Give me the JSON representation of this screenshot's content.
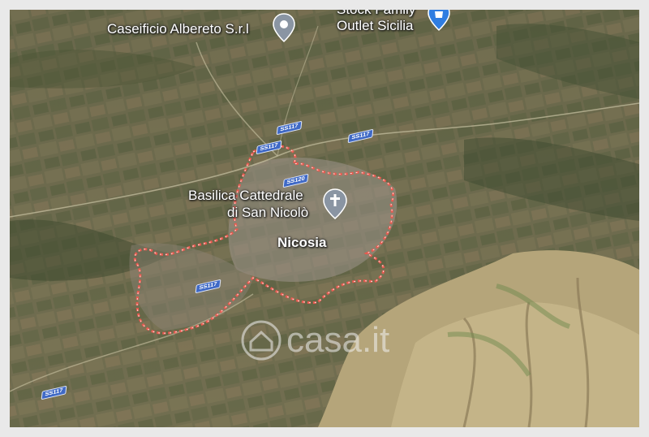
{
  "places": [
    {
      "id": "caseificio",
      "text": "Caseificio Albereto S.r.l"
    },
    {
      "id": "outlet-top",
      "text": "Stock Family"
    },
    {
      "id": "outlet",
      "text": "Outlet Sicilia"
    },
    {
      "id": "basilica-1",
      "text": "Basilica Cattedrale"
    },
    {
      "id": "basilica-2",
      "text": "di San Nicolò"
    },
    {
      "id": "town",
      "text": "Nicosia"
    }
  ],
  "road_shields": [
    "SS117",
    "SS117",
    "SS117",
    "SS120",
    "SS117",
    "SS117"
  ],
  "watermark": {
    "brand": "casa.it"
  },
  "colors": {
    "terrain": "#6b6a4c",
    "boundary": "#e85a4f",
    "shield": "#3f69c6",
    "pin": "#8a95a3"
  },
  "icons": [
    "place-pin-icon",
    "church-pin-icon",
    "shopping-pin-icon",
    "house-logo-icon"
  ]
}
